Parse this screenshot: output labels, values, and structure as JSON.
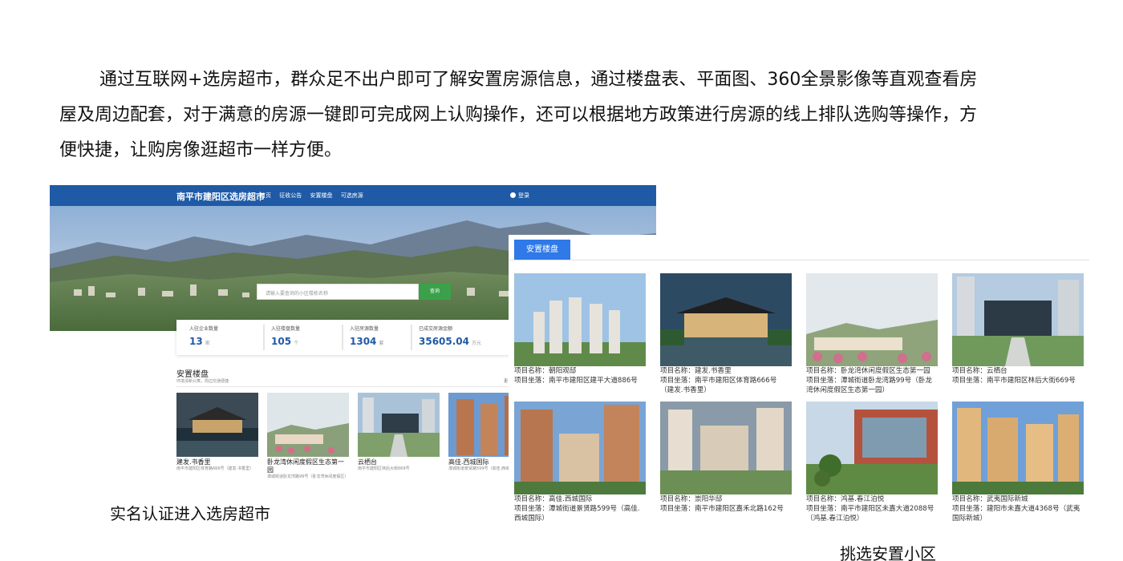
{
  "intro": {
    "line1": "通过互联网+选房超市，群众足不出户即可了解安置房源信息，通过楼盘表、平面图、360全景影像等直观查看房",
    "line2": "屋及周边配套，对于满意的房源一键即可完成网上认购操作，还可以根据地方政策进行房源的线上排队选购等操作，方",
    "line3": "便快捷，让购房像逛超市一样方便。"
  },
  "site1": {
    "brand": "南平市建阳区选房超市",
    "nav": [
      "首页",
      "征收公告",
      "安置楼盘",
      "可选房源"
    ],
    "login": "登录",
    "search_placeholder": "请输入要查询的小区楼栋名称",
    "search_button": "查询",
    "stats": [
      {
        "label": "入驻企业数量",
        "value": "13",
        "unit": "家"
      },
      {
        "label": "入驻楼盘数量",
        "value": "105",
        "unit": "个"
      },
      {
        "label": "入驻房源数量",
        "value": "1304",
        "unit": "套"
      },
      {
        "label": "已成交房源金额",
        "value": "35605.04",
        "unit": "万元"
      }
    ],
    "section_title": "安置楼盘",
    "section_sub": "环境清新公寓，周边交通便捷",
    "section_more": "更",
    "cards": [
      {
        "name": "建发.书香里",
        "addr": "南平市建阳区体育路666号（建发.书香里）"
      },
      {
        "name": "卧龙湾休闲度假区生态第一园",
        "addr": "潭城街道卧龙湾路99号（卧龙湾休闲度假区）"
      },
      {
        "name": "云栖台",
        "addr": "南平市建阳区林后大街669号"
      },
      {
        "name": "高佳.西城国际",
        "addr": "潭城街道景贤路599号（高佳.西城国际）"
      }
    ]
  },
  "site2": {
    "tab": "安置楼盘",
    "cards": [
      {
        "l1": "项目名称：朝阳观邸",
        "l2": "项目坐落：南平市建阳区建平大道886号",
        "l3": ""
      },
      {
        "l1": "项目名称：建发.书香里",
        "l2": "项目坐落：南平市建阳区体育路666号",
        "l3": "（建发.书香里）"
      },
      {
        "l1": "项目名称：卧龙湾休闲度假区生态第一园",
        "l2": "项目坐落：潭城街道卧龙湾路99号（卧龙",
        "l3": "湾休闲度假区生态第一园）"
      },
      {
        "l1": "项目名称：云栖台",
        "l2": "项目坐落：南平市建阳区林后大街669号",
        "l3": ""
      },
      {
        "l1": "项目名称：高佳.西城国际",
        "l2": "项目坐落：潭城街道景贤路599号（高佳.",
        "l3": "西城国际）"
      },
      {
        "l1": "项目名称：崇阳华邸",
        "l2": "项目坐落：南平市建阳区嘉禾北路162号",
        "l3": ""
      },
      {
        "l1": "项目名称：鸿基.春江泊悦",
        "l2": "项目坐落：南平市建阳区未嘉大道2088号",
        "l3": "（鸿基.春江泊悦）"
      },
      {
        "l1": "项目名称：武夷国际新城",
        "l2": "项目坐落：建阳市未嘉大道4368号（武夷",
        "l3": "国际新城）"
      }
    ]
  },
  "captions": {
    "left": "实名认证进入选房超市",
    "right": "挑选安置小区"
  }
}
